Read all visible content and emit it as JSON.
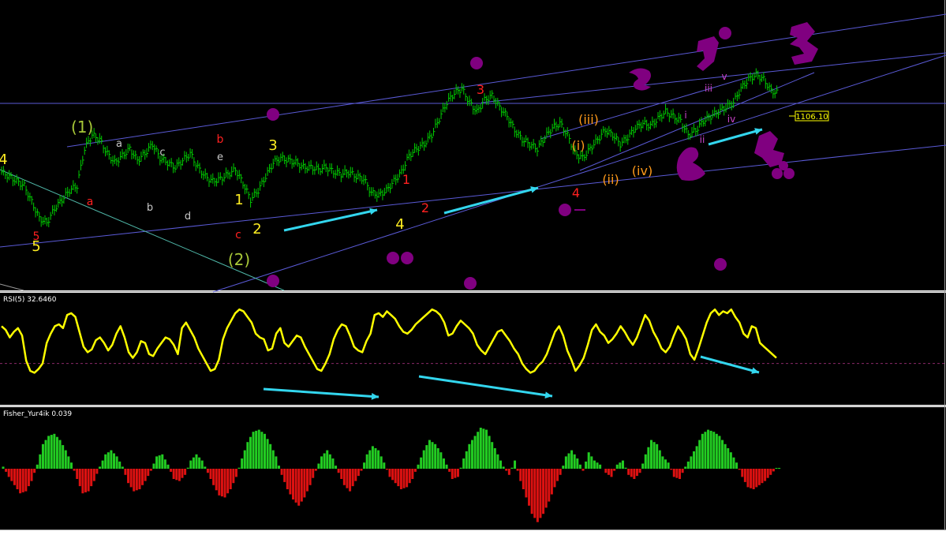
{
  "colors": {
    "background": "#000000",
    "price_bars": "#00cc00",
    "trendlines": "#5a5ad6",
    "rsi_line": "#ffff00",
    "rsi_level": "#8b2a6a",
    "divergence_arrows": "#33d6ee",
    "fisher_positive": "#22cc22",
    "fisher_negative": "#dd1111",
    "markers": "#800080",
    "price_tag": "#ffff00",
    "wave_red": "#ff2020",
    "wave_yellow": "#ffee22",
    "wave_olive": "#a8c838",
    "wave_orange": "#ff9a1a",
    "wave_violet": "#cc44cc",
    "wave_grey": "#c8c8c8"
  },
  "price_panel": {
    "current_price": "1106.10",
    "wave_labels": [
      {
        "text": "(1)",
        "color": "olive"
      },
      {
        "text": "(2)",
        "color": "olive"
      },
      {
        "text": "1",
        "color": "yellow"
      },
      {
        "text": "2",
        "color": "yellow"
      },
      {
        "text": "3",
        "color": "yellow"
      },
      {
        "text": "4",
        "color": "yellow"
      },
      {
        "text": "4",
        "color": "yellow"
      },
      {
        "text": "5",
        "color": "yellow"
      },
      {
        "text": "5",
        "color": "red"
      },
      {
        "text": "a",
        "color": "red"
      },
      {
        "text": "b",
        "color": "red"
      },
      {
        "text": "c",
        "color": "red"
      },
      {
        "text": "1",
        "color": "red"
      },
      {
        "text": "2",
        "color": "red"
      },
      {
        "text": "3",
        "color": "red"
      },
      {
        "text": "4",
        "color": "red"
      },
      {
        "text": "a",
        "color": "grey"
      },
      {
        "text": "b",
        "color": "grey"
      },
      {
        "text": "c",
        "color": "grey"
      },
      {
        "text": "d",
        "color": "grey"
      },
      {
        "text": "e",
        "color": "grey"
      },
      {
        "text": "(i)",
        "color": "orange"
      },
      {
        "text": "(ii)",
        "color": "orange"
      },
      {
        "text": "(iii)",
        "color": "orange"
      },
      {
        "text": "(iv)",
        "color": "orange"
      },
      {
        "text": "i",
        "color": "violet"
      },
      {
        "text": "ii",
        "color": "violet"
      },
      {
        "text": "iii",
        "color": "violet"
      },
      {
        "text": "iv",
        "color": "violet"
      },
      {
        "text": "v",
        "color": "violet"
      }
    ]
  },
  "rsi_panel": {
    "title": "RSI(5) 32.6460"
  },
  "fisher_panel": {
    "title": "Fisher_Yur4ik 0.039"
  },
  "chart_data": [
    {
      "type": "line",
      "panel": "price",
      "last": 1106.1,
      "series": [
        {
          "values": [
            1078,
            1076,
            1074,
            1072,
            1065,
            1058,
            1056,
            1062,
            1066,
            1070,
            1072,
            1088,
            1094,
            1092,
            1086,
            1082,
            1085,
            1088,
            1083,
            1086,
            1090,
            1084,
            1082,
            1080,
            1083,
            1086,
            1080,
            1076,
            1074,
            1075,
            1077,
            1079,
            1073,
            1066,
            1070,
            1076,
            1082,
            1084,
            1083,
            1082,
            1080,
            1080,
            1079,
            1080,
            1078,
            1077,
            1078,
            1076,
            1075,
            1069,
            1068,
            1070,
            1074,
            1078,
            1085,
            1088,
            1090,
            1094,
            1101,
            1108,
            1112,
            1114,
            1108,
            1104,
            1109,
            1111,
            1106,
            1102,
            1096,
            1092,
            1090,
            1088,
            1093,
            1097,
            1099,
            1094,
            1086,
            1084,
            1088,
            1092,
            1096,
            1094,
            1090,
            1093,
            1097,
            1099,
            1098,
            1101,
            1104,
            1102,
            1100,
            1094,
            1096,
            1100,
            1102,
            1104,
            1106,
            1108,
            1114,
            1118,
            1120,
            1118,
            1113,
            1112
          ]
        }
      ]
    },
    {
      "type": "line",
      "panel": "rsi",
      "ylim": [
        0,
        100
      ],
      "levels": [
        30
      ],
      "last": 32.646,
      "series": [
        {
          "values": [
            70,
            66,
            58,
            64,
            68,
            60,
            33,
            22,
            20,
            24,
            30,
            52,
            62,
            70,
            72,
            68,
            82,
            84,
            80,
            64,
            48,
            42,
            45,
            55,
            58,
            52,
            44,
            50,
            62,
            70,
            58,
            42,
            36,
            42,
            54,
            52,
            40,
            38,
            46,
            52,
            58,
            56,
            50,
            40,
            68,
            74,
            66,
            58,
            46,
            38,
            30,
            22,
            24,
            34,
            56,
            68,
            76,
            84,
            88,
            86,
            80,
            74,
            62,
            58,
            56,
            44,
            46,
            62,
            68,
            52,
            48,
            54,
            60,
            58,
            48,
            40,
            32,
            24,
            22,
            30,
            40,
            56,
            66,
            72,
            70,
            60,
            48,
            44,
            42,
            54,
            62,
            82,
            84,
            80,
            86,
            82,
            78,
            70,
            64,
            62,
            66,
            72,
            76,
            80,
            84,
            88,
            86,
            82,
            74,
            60,
            62,
            70,
            76,
            72,
            68,
            62,
            50,
            44,
            40,
            48,
            56,
            64,
            66,
            60,
            54,
            46,
            40,
            30,
            24,
            20,
            22,
            28,
            32,
            40,
            52,
            64,
            70,
            60,
            44,
            34,
            22,
            28,
            36,
            50,
            66,
            72,
            64,
            60,
            52,
            56,
            62,
            70,
            64,
            56,
            50,
            58,
            70,
            82,
            76,
            64,
            56,
            46,
            42,
            48,
            60,
            70,
            64,
            56,
            40,
            34,
            46,
            60,
            74,
            84,
            88,
            82,
            86,
            84,
            88,
            80,
            74,
            62,
            58,
            70,
            68,
            52,
            48,
            44,
            40,
            36
          ]
        }
      ]
    },
    {
      "type": "bar",
      "panel": "fisher",
      "last": 0.039,
      "series": [
        {
          "values": [
            0.1,
            -0.4,
            -0.8,
            -1.2,
            -1.1,
            -0.6,
            0.2,
            1.2,
            1.6,
            1.7,
            1.4,
            0.9,
            0.3,
            -0.5,
            -1.2,
            -1.1,
            -0.6,
            0.1,
            0.7,
            0.9,
            0.6,
            0.1,
            -0.7,
            -1.1,
            -1.0,
            -0.6,
            -0.1,
            0.6,
            0.7,
            0.2,
            -0.5,
            -0.6,
            -0.3,
            0.4,
            0.7,
            0.4,
            -0.2,
            -0.8,
            -1.3,
            -1.4,
            -1.0,
            -0.4,
            0.5,
            1.3,
            1.8,
            1.9,
            1.7,
            1.2,
            0.6,
            -0.3,
            -1.0,
            -1.5,
            -1.8,
            -1.4,
            -0.8,
            -0.1,
            0.6,
            0.9,
            0.5,
            -0.2,
            -0.8,
            -1.1,
            -0.6,
            -0.1,
            0.7,
            1.1,
            0.9,
            0.3,
            -0.4,
            -0.7,
            -1.0,
            -0.9,
            -0.5,
            0.2,
            0.9,
            1.4,
            1.2,
            0.8,
            0.2,
            -0.5,
            -0.4,
            0.5,
            1.2,
            1.6,
            2.0,
            1.9,
            1.3,
            0.7,
            0.1,
            -0.3,
            0.4,
            -0.6,
            -1.4,
            -2.2,
            -2.6,
            -2.2,
            -1.6,
            -0.9,
            -0.3,
            0.6,
            0.9,
            0.5,
            -0.1,
            0.8,
            0.4,
            0.2,
            -0.2,
            -0.4,
            0.2,
            0.4,
            -0.3,
            -0.5,
            -0.2,
            0.7,
            1.4,
            1.2,
            0.6,
            0.3,
            -0.4,
            -0.5,
            0.1,
            0.6,
            1.1,
            1.7,
            1.9,
            1.8,
            1.6,
            1.2,
            0.8,
            0.3,
            -0.4,
            -0.9,
            -1.0,
            -0.8,
            -0.6,
            -0.3,
            0.04
          ]
        }
      ]
    }
  ]
}
